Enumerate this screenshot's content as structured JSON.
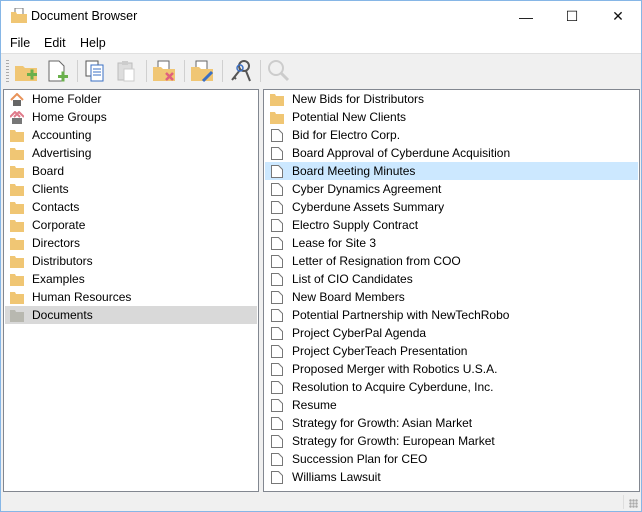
{
  "window": {
    "title": "Document Browser",
    "controls": {
      "minimize": "—",
      "maximize": "☐",
      "close": "✕"
    }
  },
  "menu": [
    "File",
    "Edit",
    "Help"
  ],
  "toolbar": [
    {
      "icon": "new-folder-icon"
    },
    {
      "icon": "new-document-icon"
    },
    {
      "sep": true
    },
    {
      "icon": "copy-icon"
    },
    {
      "icon": "paste-icon",
      "disabled": true
    },
    {
      "sep": true
    },
    {
      "icon": "delete-folder-icon"
    },
    {
      "sep": true
    },
    {
      "icon": "edit-folder-icon"
    },
    {
      "sep": true
    },
    {
      "icon": "keys-icon"
    },
    {
      "sep": true
    },
    {
      "icon": "search-icon",
      "disabled": true
    }
  ],
  "folders": [
    {
      "label": "Home Folder",
      "icon": "home"
    },
    {
      "label": "Home Groups",
      "icon": "homegroup"
    },
    {
      "label": "Accounting",
      "icon": "folder"
    },
    {
      "label": "Advertising",
      "icon": "folder"
    },
    {
      "label": "Board",
      "icon": "folder"
    },
    {
      "label": "Clients",
      "icon": "folder"
    },
    {
      "label": "Contacts",
      "icon": "folder"
    },
    {
      "label": "Corporate",
      "icon": "folder"
    },
    {
      "label": "Directors",
      "icon": "folder"
    },
    {
      "label": "Distributors",
      "icon": "folder"
    },
    {
      "label": "Examples",
      "icon": "folder"
    },
    {
      "label": "Human Resources",
      "icon": "folder"
    },
    {
      "label": "Documents",
      "icon": "folder-grey",
      "selected": true
    }
  ],
  "files": [
    {
      "label": "New Bids for Distributors",
      "icon": "folder"
    },
    {
      "label": "Potential New Clients",
      "icon": "folder"
    },
    {
      "label": "Bid for Electro Corp.",
      "icon": "doc"
    },
    {
      "label": "Board Approval of Cyberdune Acquisition",
      "icon": "doc"
    },
    {
      "label": "Board Meeting Minutes",
      "icon": "doc",
      "highlighted": true
    },
    {
      "label": "Cyber Dynamics Agreement",
      "icon": "doc"
    },
    {
      "label": "Cyberdune Assets Summary",
      "icon": "doc"
    },
    {
      "label": "Electro Supply Contract",
      "icon": "doc"
    },
    {
      "label": "Lease for Site 3",
      "icon": "doc"
    },
    {
      "label": "Letter of Resignation from COO",
      "icon": "doc"
    },
    {
      "label": "List of CIO Candidates",
      "icon": "doc"
    },
    {
      "label": "New Board Members",
      "icon": "doc"
    },
    {
      "label": "Potential Partnership with NewTechRobo",
      "icon": "doc"
    },
    {
      "label": "Project CyberPal Agenda",
      "icon": "doc"
    },
    {
      "label": "Project CyberTeach Presentation",
      "icon": "doc"
    },
    {
      "label": "Proposed Merger with Robotics U.S.A.",
      "icon": "doc"
    },
    {
      "label": "Resolution to Acquire Cyberdune, Inc.",
      "icon": "doc"
    },
    {
      "label": "Resume",
      "icon": "doc"
    },
    {
      "label": "Strategy for Growth: Asian Market",
      "icon": "doc"
    },
    {
      "label": "Strategy for Growth: European Market",
      "icon": "doc"
    },
    {
      "label": "Succession Plan for CEO",
      "icon": "doc"
    },
    {
      "label": "Williams Lawsuit",
      "icon": "doc"
    }
  ],
  "colors": {
    "folder": "#f0c674",
    "selection": "#d9d9d9",
    "highlight": "#cce8ff",
    "border": "#86b6e6"
  }
}
